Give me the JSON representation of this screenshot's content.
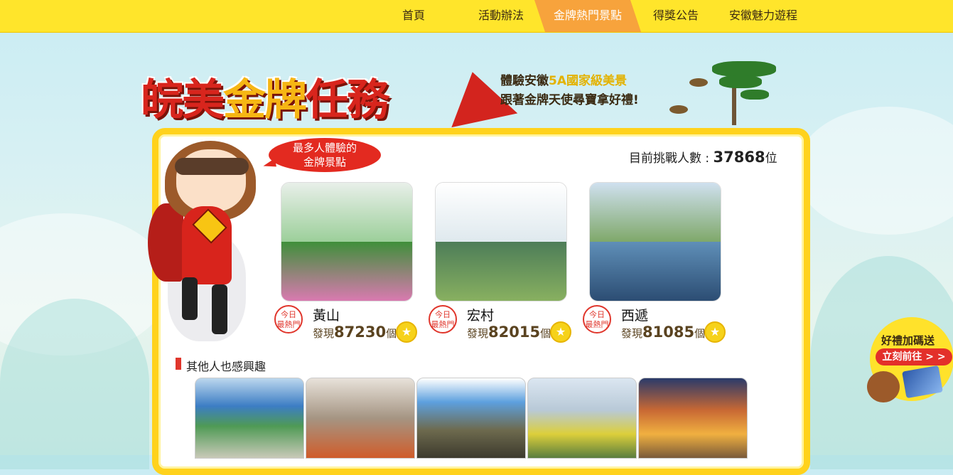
{
  "nav": {
    "items": [
      {
        "label": "首頁"
      },
      {
        "label": "活動辦法"
      },
      {
        "label": "金牌熱門景點"
      },
      {
        "label": "得獎公告"
      },
      {
        "label": "安徽魅力遊程"
      }
    ],
    "active_index": 2
  },
  "title": {
    "part1": "皖美",
    "part2": "金牌",
    "part3": "任務"
  },
  "slogan": {
    "line1_a": "體驗安徽",
    "line1_b": "5A國家級美景",
    "line2": "跟著金牌天使尋寶拿好禮!"
  },
  "bubble": {
    "line1": "最多人體驗的",
    "line2": "金牌景點"
  },
  "stats": {
    "label": "目前挑戰人數 : ",
    "value": "37868",
    "unit": "位"
  },
  "top_spots": [
    {
      "badge_l1": "今日",
      "badge_l2": "最熱門",
      "name": "黃山",
      "prefix": "發現",
      "count": "87230",
      "suffix": "個"
    },
    {
      "badge_l1": "今日",
      "badge_l2": "最熱門",
      "name": "宏村",
      "prefix": "發現",
      "count": "82015",
      "suffix": "個"
    },
    {
      "badge_l1": "今日",
      "badge_l2": "最熱門",
      "name": "西遞",
      "prefix": "發現",
      "count": "81085",
      "suffix": "個"
    }
  ],
  "section": {
    "title": "其他人也感興趣"
  },
  "promo": {
    "title": "好禮加碼送",
    "button": "立刻前往 > >"
  },
  "colors": {
    "nav_bg": "#ffe52b",
    "nav_active": "#f7a33c",
    "accent_red": "#e0362c",
    "panel_border": "#ffd21c"
  }
}
